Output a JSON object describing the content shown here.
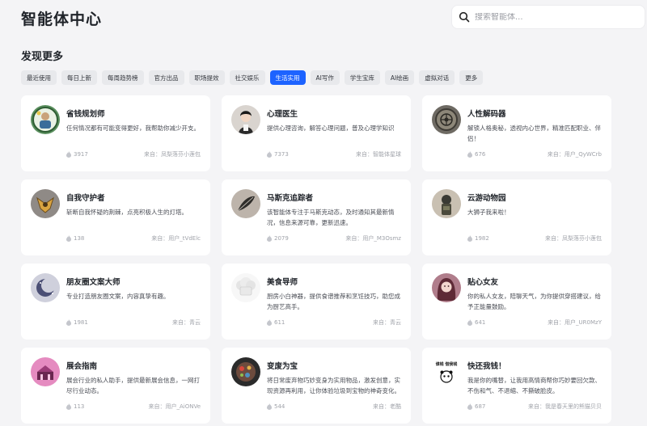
{
  "header": {
    "title": "智能体中心",
    "search_placeholder": "搜索智能体..."
  },
  "section_title": "发现更多",
  "filters": [
    {
      "label": "最近使用",
      "active": false
    },
    {
      "label": "每日上新",
      "active": false
    },
    {
      "label": "每周趋势榜",
      "active": false
    },
    {
      "label": "官方出品",
      "active": false
    },
    {
      "label": "职场提效",
      "active": false
    },
    {
      "label": "社交娱乐",
      "active": false
    },
    {
      "label": "生活实用",
      "active": true
    },
    {
      "label": "AI写作",
      "active": false
    },
    {
      "label": "学生宝库",
      "active": false
    },
    {
      "label": "AI绘画",
      "active": false
    },
    {
      "label": "虚拟对话",
      "active": false
    },
    {
      "label": "更多",
      "active": false
    }
  ],
  "agents": [
    {
      "name": "省钱规划师",
      "desc": "任何情况都有可能变得更好，我帮助你减少开支。",
      "uses": "3917",
      "source": "来自：凤梨落芬小莲包",
      "icon": "money-planner-avatar"
    },
    {
      "name": "心理医生",
      "desc": "提供心理咨询，解答心理问题，普及心理学知识",
      "uses": "7373",
      "source": "来自：智能体星球",
      "icon": "psychologist-avatar"
    },
    {
      "name": "人性解码器",
      "desc": "解锁人格奥秘，透视内心世界，精准匹配职业、伴侣！",
      "uses": "676",
      "source": "来自：用户_QyWCrb",
      "icon": "decoder-avatar"
    },
    {
      "name": "自我守护者",
      "desc": "斩断自我怀疑的荆棘，点亮积极人生的灯塔。",
      "uses": "138",
      "source": "来自：用户_tVdElc",
      "icon": "guardian-avatar"
    },
    {
      "name": "马斯克追踪者",
      "desc": "该智能体专注于马斯克动态，及时通知其最新情况，信息来源可靠，更新迅速。",
      "uses": "2079",
      "source": "来自：用户_M3Osmz",
      "icon": "feather-avatar"
    },
    {
      "name": "云游动物园",
      "desc": "大狮子我来啦！",
      "uses": "1982",
      "source": "来自：凤梨落芬小莲包",
      "icon": "zoo-avatar"
    },
    {
      "name": "朋友圈文案大师",
      "desc": "专业打造朋友圈文案，内容真挚有趣。",
      "uses": "1981",
      "source": "来自：青云",
      "icon": "moon-avatar"
    },
    {
      "name": "美食导师",
      "desc": "厨房小白神器，提供食谱推荐和烹饪技巧，助您成为厨艺高手。",
      "uses": "611",
      "source": "来自：青云",
      "icon": "chef-hat-avatar"
    },
    {
      "name": "贴心女友",
      "desc": "你的私人女友，陪聊天气，为你提供穿搭建议，给予正能量鼓励。",
      "uses": "641",
      "source": "来自：用户_UR0MzY",
      "icon": "girlfriend-avatar"
    },
    {
      "name": "展会指南",
      "desc": "展会行业的私人助手，提供最新展会信息，一网打尽行业动态。",
      "uses": "113",
      "source": "来自：用户_AiONVe",
      "icon": "expo-avatar"
    },
    {
      "name": "变废为宝",
      "desc": "将日常废弃物巧妙变身为实用物品，激发创意，实现资源再利用，让你体验垃圾到宝物的神奇变化。",
      "uses": "544",
      "source": "来自：老酷",
      "icon": "recycle-avatar"
    },
    {
      "name": "快还我钱！",
      "desc": "我是你的嘴替，让我用高情商帮你巧妙要回欠款、不伤和气、不退缩、不撕破脸皮。",
      "uses": "687",
      "source": "来自：我是春天里的熊猫贝贝",
      "icon": "panda-avatar",
      "avatar_text": "谁钱 借我钱"
    }
  ],
  "colors": {
    "accent": "#1d63ff",
    "background": "#f4f4f6",
    "card": "#ffffff"
  }
}
